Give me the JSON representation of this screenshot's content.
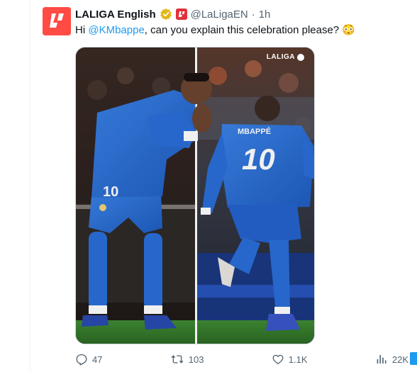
{
  "tweet": {
    "display_name": "LALIGA English",
    "handle": "@LaLigaEN",
    "separator": "·",
    "time": "1h",
    "text_before": "Hi ",
    "mention": "@KMbappe",
    "text_after": ", can you explain this celebration please? 😳",
    "media": {
      "brand_text": "LALIGA",
      "left_jersey_number": "10",
      "right_jersey_number": "10",
      "right_jersey_name": "MBAPPÉ"
    },
    "stats": {
      "replies": "47",
      "retweets": "103",
      "likes": "1.1K",
      "views": "22K"
    }
  },
  "colors": {
    "brand_red": "#ff4b44",
    "link_blue": "#1d9bf0",
    "muted": "#536471",
    "kit_blue": "#2d6fd4"
  },
  "icons": [
    "verified-badge-icon",
    "affiliate-badge-icon",
    "reply-icon",
    "retweet-icon",
    "like-icon",
    "views-icon",
    "bookmark-icon"
  ]
}
